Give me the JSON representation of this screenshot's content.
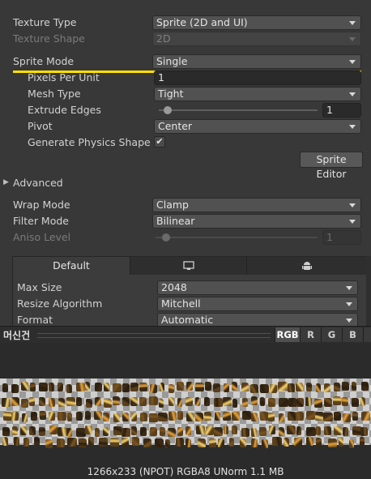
{
  "texture_type": {
    "label": "Texture Type",
    "value": "Sprite (2D and UI)"
  },
  "texture_shape": {
    "label": "Texture Shape",
    "value": "2D"
  },
  "sprite_mode": {
    "label": "Sprite Mode",
    "value": "Single"
  },
  "pixels_per_unit": {
    "label": "Pixels Per Unit",
    "value": "1"
  },
  "mesh_type": {
    "label": "Mesh Type",
    "value": "Tight"
  },
  "extrude_edges": {
    "label": "Extrude Edges",
    "value": "1",
    "slider_fraction": 0.03
  },
  "pivot": {
    "label": "Pivot",
    "value": "Center"
  },
  "generate_physics_shape": {
    "label": "Generate Physics Shape",
    "checked": true,
    "check_glyph": "✔"
  },
  "sprite_editor_button": "Sprite Editor",
  "advanced": {
    "label": "Advanced",
    "arrow": "▶"
  },
  "wrap_mode": {
    "label": "Wrap Mode",
    "value": "Clamp"
  },
  "filter_mode": {
    "label": "Filter Mode",
    "value": "Bilinear"
  },
  "aniso_level": {
    "label": "Aniso Level",
    "value": "1",
    "slider_fraction": 0.1
  },
  "platform_tabs": [
    {
      "label": "Default",
      "icon": ""
    },
    {
      "label": "",
      "icon": "monitor-icon"
    },
    {
      "label": "",
      "icon": "android-icon"
    }
  ],
  "max_size": {
    "label": "Max Size",
    "value": "2048"
  },
  "resize_algorithm": {
    "label": "Resize Algorithm",
    "value": "Mitchell"
  },
  "format": {
    "label": "Format",
    "value": "Automatic"
  },
  "preview": {
    "name": "머신건",
    "channels": [
      "RGB",
      "R",
      "G",
      "B"
    ],
    "active_channel": "RGB",
    "info": "1266x233 (NPOT)  RGBA8 UNorm   1.1 MB"
  },
  "colors": {
    "highlight": "#ffe100",
    "background": "#383838"
  }
}
